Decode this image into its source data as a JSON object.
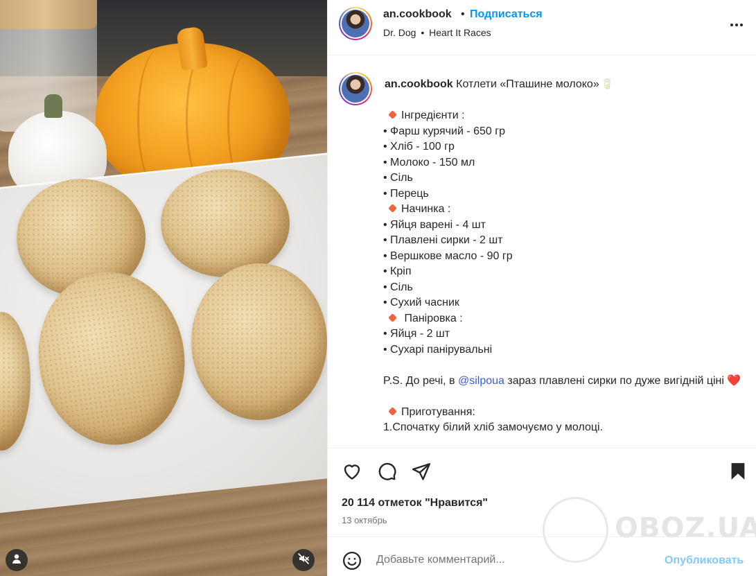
{
  "post": {
    "username": "an.cookbook",
    "separator": "•",
    "follow_label": "Подписаться",
    "audio": {
      "artist": "Dr. Dog",
      "separator": "•",
      "track": "Heart It Races"
    },
    "more_icon": "more-horizontal-icon"
  },
  "caption": {
    "username": "an.cookbook",
    "title": " Котлети «Пташине молоко»",
    "title_emoji": "🥛",
    "lines": [
      {
        "type": "section",
        "text": "Інгредієнти :"
      },
      {
        "type": "item",
        "text": "• Фарш курячий - 650 гр"
      },
      {
        "type": "item",
        "text": "• Хліб - 100 гр"
      },
      {
        "type": "item",
        "text": "• Молоко - 150 мл"
      },
      {
        "type": "item",
        "text": "• Сіль"
      },
      {
        "type": "item",
        "text": "• Перець"
      },
      {
        "type": "section",
        "text": "Начинка :"
      },
      {
        "type": "item",
        "text": "• Яйця варені - 4 шт"
      },
      {
        "type": "item",
        "text": "• Плавлені сирки - 2 шт"
      },
      {
        "type": "item",
        "text": "• Вершкове масло - 90 гр"
      },
      {
        "type": "item",
        "text": "• Кріп"
      },
      {
        "type": "item",
        "text": "• Сіль"
      },
      {
        "type": "item",
        "text": "• Сухий часник"
      },
      {
        "type": "section",
        "text": " Паніровка :"
      },
      {
        "type": "item",
        "text": "• Яйця - 2 шт"
      },
      {
        "type": "item",
        "text": "• Сухарі панірувальні"
      }
    ],
    "ps_prefix": "P.S. До речі, в ",
    "ps_mention": "@silpoua",
    "ps_suffix": " зараз плавлені сирки по дуже вигідній ціні ",
    "ps_emoji": "❤️",
    "cooking_section": "Приготування:",
    "step1": "1.Спочатку білий хліб замочуємо у молоці."
  },
  "actions": {
    "like_icon": "heart-icon",
    "comment_icon": "comment-icon",
    "share_icon": "send-icon",
    "save_icon": "bookmark-icon",
    "likes_text": "20 114 отметок \"Нравится\"",
    "date": "13 октябрь"
  },
  "watermark": {
    "text": "OBOZ.UA"
  },
  "comment": {
    "emoji_icon": "smile-icon",
    "placeholder": "Добавьте комментарий...",
    "publish_label": "Опубликовать"
  },
  "media": {
    "user_icon": "user-tag-icon",
    "mute_icon": "muted-speaker-icon"
  },
  "colors": {
    "link": "#0095f6",
    "publish_disabled": "#85c7f8",
    "section_marker": "#f0643c",
    "mention": "#3b5bdb"
  }
}
